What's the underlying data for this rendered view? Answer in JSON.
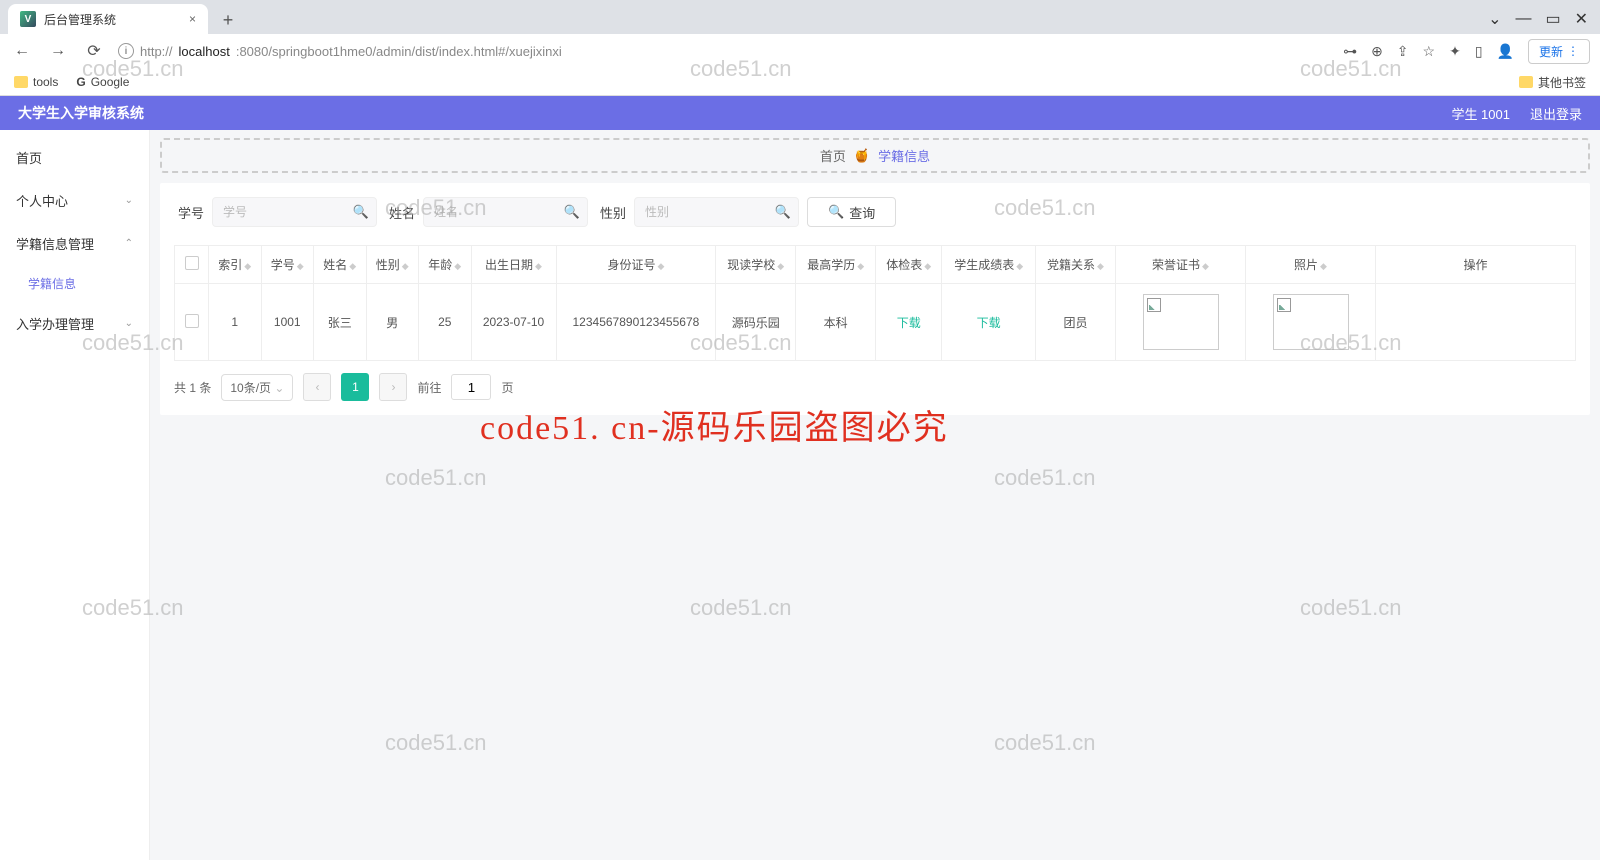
{
  "browser": {
    "tab_title": "后台管理系统",
    "url_prefix": "http://",
    "url_host": "localhost",
    "url_path": ":8080/springboot1hme0/admin/dist/index.html#/xuejixinxi",
    "update_label": "更新",
    "bookmarks": {
      "tools": "tools",
      "google": "Google",
      "other": "其他书签"
    }
  },
  "header": {
    "title": "大学生入学审核系统",
    "user_role": "学生 1001",
    "logout": "退出登录"
  },
  "sidebar": {
    "home": "首页",
    "personal": "个人中心",
    "xueji_mgmt": "学籍信息管理",
    "xueji_info": "学籍信息",
    "enroll_mgmt": "入学办理管理"
  },
  "breadcrumb": {
    "home": "首页",
    "icon": "🍯",
    "current": "学籍信息"
  },
  "search": {
    "sno_label": "学号",
    "sno_ph": "学号",
    "name_label": "姓名",
    "name_ph": "姓名",
    "gender_label": "性别",
    "gender_ph": "性别",
    "query_btn": "查询"
  },
  "table": {
    "cols": {
      "idx": "索引",
      "sno": "学号",
      "name": "姓名",
      "gender": "性别",
      "age": "年龄",
      "birth": "出生日期",
      "idcard": "身份证号",
      "school": "现读学校",
      "edu": "最高学历",
      "medical": "体检表",
      "grades": "学生成绩表",
      "party": "党籍关系",
      "honor": "荣誉证书",
      "photo": "照片",
      "ops": "操作"
    },
    "row": {
      "idx": "1",
      "sno": "1001",
      "name": "张三",
      "gender": "男",
      "age": "25",
      "birth": "2023-07-10",
      "idcard": "1234567890123455678",
      "school": "源码乐园",
      "edu": "本科",
      "medical": "下载",
      "grades": "下载",
      "party": "团员"
    }
  },
  "pager": {
    "total": "共 1 条",
    "per_page": "10条/页",
    "current": "1",
    "goto_label": "前往",
    "goto_val": "1",
    "page_suffix": "页"
  },
  "watermarks": {
    "w": "code51.cn",
    "red": "code51. cn-源码乐园盗图必究"
  }
}
